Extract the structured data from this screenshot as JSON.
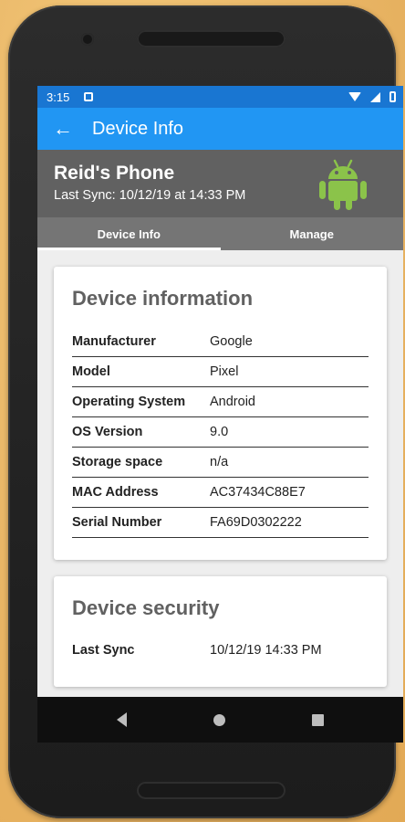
{
  "status_bar": {
    "time": "3:15"
  },
  "app_bar": {
    "title": "Device Info"
  },
  "device": {
    "name": "Reid's Phone",
    "last_sync": "Last Sync: 10/12/19 at 14:33 PM",
    "os_icon": "android-icon"
  },
  "tabs": [
    {
      "label": "Device Info",
      "active": true
    },
    {
      "label": "Manage",
      "active": false
    }
  ],
  "device_information": {
    "title": "Device information",
    "rows": [
      {
        "label": "Manufacturer",
        "value": "Google"
      },
      {
        "label": "Model",
        "value": "Pixel"
      },
      {
        "label": "Operating System",
        "value": "Android"
      },
      {
        "label": "OS Version",
        "value": "9.0"
      },
      {
        "label": "Storage space",
        "value": "n/a"
      },
      {
        "label": "MAC Address",
        "value": "AC37434C88E7"
      },
      {
        "label": "Serial Number",
        "value": "FA69D0302222"
      }
    ]
  },
  "device_security": {
    "title": "Device security",
    "rows": [
      {
        "label": "Last Sync",
        "value": "10/12/19 14:33 PM"
      }
    ]
  },
  "colors": {
    "primary": "#2196f3",
    "primary_dark": "#1976d2",
    "header_gray": "#616161",
    "tab_gray": "#757575",
    "android_green": "#8bc34a"
  }
}
